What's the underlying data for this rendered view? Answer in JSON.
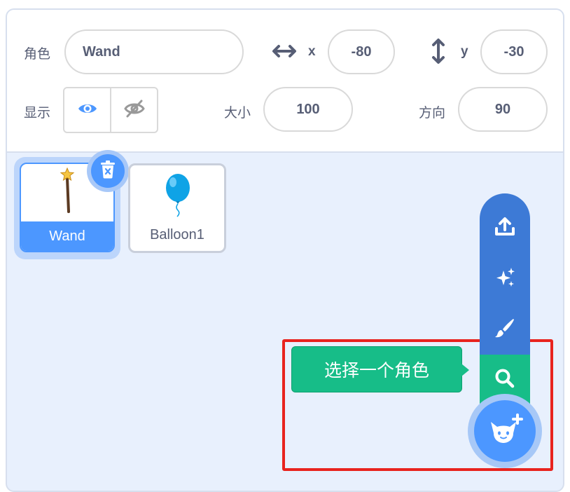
{
  "sprite_info": {
    "sprite_label": "角色",
    "sprite_name": "Wand",
    "x_label": "x",
    "x_value": "-80",
    "y_label": "y",
    "y_value": "-30",
    "show_label": "显示",
    "size_label": "大小",
    "size_value": "100",
    "direction_label": "方向",
    "direction_value": "90"
  },
  "sprites": [
    {
      "name": "Wand",
      "selected": true
    },
    {
      "name": "Balloon1",
      "selected": false
    }
  ],
  "sprite_menu": {
    "tooltip": "选择一个角色",
    "items": [
      "upload-icon",
      "surprise-icon",
      "paint-icon",
      "search-icon"
    ],
    "main_button_icon": "cat-plus-icon"
  },
  "colors": {
    "accent": "#4c97ff",
    "menu": "#3d7ad6",
    "active": "#17bd88",
    "highlight": "#e8231e"
  }
}
